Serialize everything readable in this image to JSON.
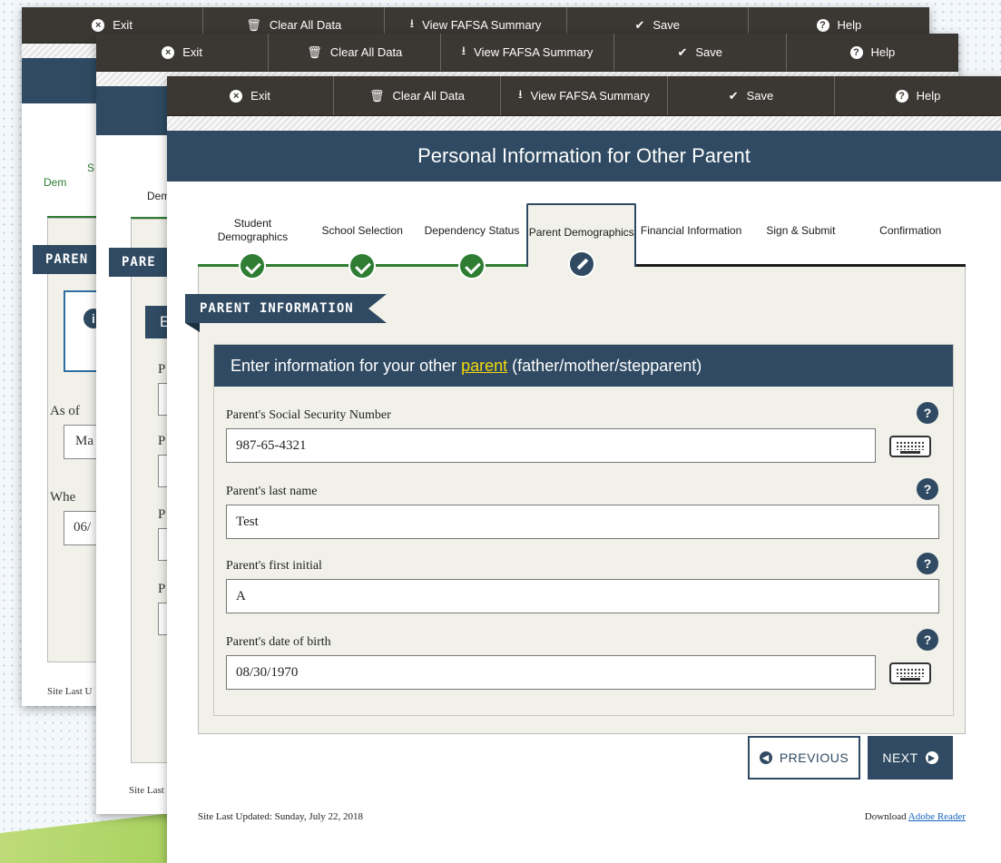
{
  "toolbar": {
    "exit": "Exit",
    "clear": "Clear All Data",
    "summary": "View FAFSA Summary",
    "save": "Save",
    "help": "Help"
  },
  "page_title": "Personal Information for Other Parent",
  "steps": [
    {
      "label": "Student Demographics",
      "state": "done"
    },
    {
      "label": "School Selection",
      "state": "done"
    },
    {
      "label": "Dependency Status",
      "state": "done"
    },
    {
      "label": "Parent Demographics",
      "state": "active"
    },
    {
      "label": "Financial Information",
      "state": "todo"
    },
    {
      "label": "Sign & Submit",
      "state": "todo"
    },
    {
      "label": "Confirmation",
      "state": "todo"
    }
  ],
  "section_ribbon": "PARENT INFORMATION",
  "card": {
    "heading_before": "Enter information for your other",
    "heading_link": "parent",
    "heading_after": "(father/mother/stepparent)"
  },
  "fields": {
    "ssn": {
      "label": "Parent's Social Security Number",
      "value": "987-65-4321"
    },
    "last_name": {
      "label": "Parent's last name",
      "value": "Test"
    },
    "first_initial": {
      "label": "Parent's first initial",
      "value": "A"
    },
    "dob": {
      "label": "Parent's date of birth",
      "value": "08/30/1970"
    }
  },
  "help_glyph": "?",
  "buttons": {
    "previous": "PREVIOUS",
    "next": "NEXT"
  },
  "footer": {
    "updated": "Site Last Updated: Sunday, July 22, 2018",
    "download_prefix": "Download",
    "download_link": "Adobe Reader"
  },
  "back_windows": {
    "w1": {
      "step_partial_1": "S",
      "step_partial_2": "Dem",
      "ribbon": "PAREN",
      "as_of": "As of",
      "select_val": "Ma",
      "when": "Whe",
      "date_val": "06/",
      "footer": "Site Last U"
    },
    "w2": {
      "step_partial": "Dem",
      "ribbon": "PARE",
      "card_partial": "E",
      "p_letter": "P",
      "footer": "Site Last"
    }
  },
  "colors": {
    "accent": "#2f4a62",
    "toolbar": "#3b3834",
    "done": "#2e7d32",
    "link_yellow": "#f5d90a"
  }
}
